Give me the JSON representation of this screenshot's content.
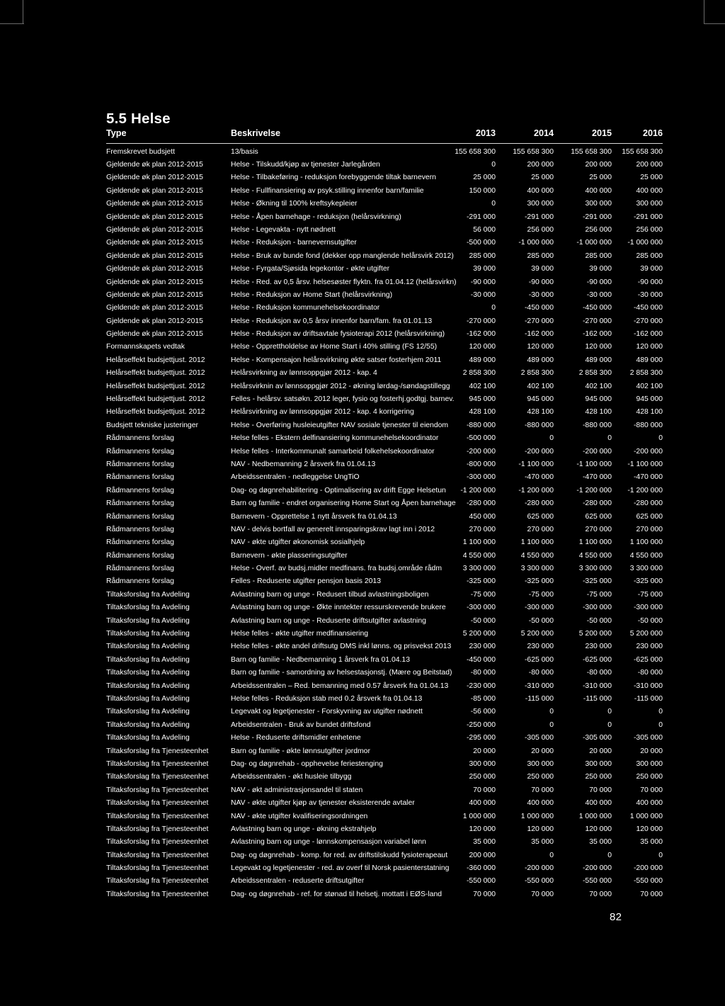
{
  "document": {
    "section_number": "5.5",
    "section_title": "5.5 Helse",
    "page_number": "82"
  },
  "table": {
    "columns": [
      {
        "key": "type",
        "label": "Type",
        "align": "left"
      },
      {
        "key": "desc",
        "label": "Beskrivelse",
        "align": "left"
      },
      {
        "key": "y2013",
        "label": "2013",
        "align": "right"
      },
      {
        "key": "y2014",
        "label": "2014",
        "align": "right"
      },
      {
        "key": "y2015",
        "label": "2015",
        "align": "right"
      },
      {
        "key": "y2016",
        "label": "2016",
        "align": "right"
      }
    ],
    "rows": [
      {
        "type": "Fremskrevet budsjett",
        "desc": "13/basis",
        "y2013": "155 658 300",
        "y2014": "155 658 300",
        "y2015": "155 658 300",
        "y2016": "155 658 300"
      },
      {
        "type": "Gjeldende øk plan 2012-2015",
        "desc": "Helse - Tilskudd/kjøp av tjenester Jarlegården",
        "y2013": "0",
        "y2014": "200 000",
        "y2015": "200 000",
        "y2016": "200 000"
      },
      {
        "type": "Gjeldende øk plan 2012-2015",
        "desc": "Helse - Tilbakeføring - reduksjon forebyggende tiltak barnevern",
        "y2013": "25 000",
        "y2014": "25 000",
        "y2015": "25 000",
        "y2016": "25 000"
      },
      {
        "type": "Gjeldende øk plan 2012-2015",
        "desc": "Helse - Fullfinansiering av psyk.stilling innenfor barn/familie",
        "y2013": "150 000",
        "y2014": "400 000",
        "y2015": "400 000",
        "y2016": "400 000"
      },
      {
        "type": "Gjeldende øk plan 2012-2015",
        "desc": "Helse - Økning til 100% kreftsykepleier",
        "y2013": "0",
        "y2014": "300 000",
        "y2015": "300 000",
        "y2016": "300 000"
      },
      {
        "type": "Gjeldende øk plan 2012-2015",
        "desc": "Helse - Åpen barnehage - reduksjon (helårsvirkning)",
        "y2013": "-291 000",
        "y2014": "-291 000",
        "y2015": "-291 000",
        "y2016": "-291 000"
      },
      {
        "type": "Gjeldende øk plan 2012-2015",
        "desc": "Helse - Legevakta - nytt nødnett",
        "y2013": "56 000",
        "y2014": "256 000",
        "y2015": "256 000",
        "y2016": "256 000"
      },
      {
        "type": "Gjeldende øk plan 2012-2015",
        "desc": "Helse - Reduksjon - barnevernsutgifter",
        "y2013": "-500 000",
        "y2014": "-1 000 000",
        "y2015": "-1 000 000",
        "y2016": "-1 000 000"
      },
      {
        "type": "Gjeldende øk plan 2012-2015",
        "desc": "Helse - Bruk av bunde fond (dekker opp manglende helårsvirk 2012)",
        "y2013": "285 000",
        "y2014": "285 000",
        "y2015": "285 000",
        "y2016": "285 000"
      },
      {
        "type": "Gjeldende øk plan 2012-2015",
        "desc": "Helse - Fyrgata/Sjøsida legekontor - økte utgifter",
        "y2013": "39 000",
        "y2014": "39 000",
        "y2015": "39 000",
        "y2016": "39 000"
      },
      {
        "type": "Gjeldende øk plan 2012-2015",
        "desc": "Helse - Red. av 0,5 årsv. helsesøster flyktn. fra 01.04.12 (helårsvirkn)",
        "y2013": "-90 000",
        "y2014": "-90 000",
        "y2015": "-90 000",
        "y2016": "-90 000"
      },
      {
        "type": "Gjeldende øk plan 2012-2015",
        "desc": "Helse - Reduksjon av Home Start (helårsvirkning)",
        "y2013": "-30 000",
        "y2014": "-30 000",
        "y2015": "-30 000",
        "y2016": "-30 000"
      },
      {
        "type": "Gjeldende øk plan 2012-2015",
        "desc": "Helse - Reduksjon kommunehelsekoordinator",
        "y2013": "0",
        "y2014": "-450 000",
        "y2015": "-450 000",
        "y2016": "-450 000"
      },
      {
        "type": "Gjeldende øk plan 2012-2015",
        "desc": "Helse - Reduksjon av 0,5 årsv innenfor barn/fam. fra 01.01.13",
        "y2013": "-270 000",
        "y2014": "-270 000",
        "y2015": "-270 000",
        "y2016": "-270 000"
      },
      {
        "type": "Gjeldende øk plan 2012-2015",
        "desc": "Helse - Reduksjon av driftsavtale fysioterapi 2012 (helårsvirkning)",
        "y2013": "-162 000",
        "y2014": "-162 000",
        "y2015": "-162 000",
        "y2016": "-162 000"
      },
      {
        "type": "Formannskapets vedtak",
        "desc": "Helse - Opprettholdelse av Home Start i 40% stilling (FS 12/55)",
        "y2013": "120 000",
        "y2014": "120 000",
        "y2015": "120 000",
        "y2016": "120 000"
      },
      {
        "type": "Helårseffekt budsjettjust. 2012",
        "desc": "Helse - Kompensajon helårsvirkning økte satser fosterhjem 2011",
        "y2013": "489 000",
        "y2014": "489 000",
        "y2015": "489 000",
        "y2016": "489 000"
      },
      {
        "type": "Helårseffekt budsjettjust. 2012",
        "desc": "Helårsvirkning av lønnsoppgjør 2012 - kap. 4",
        "y2013": "2 858 300",
        "y2014": "2 858 300",
        "y2015": "2 858 300",
        "y2016": "2 858 300"
      },
      {
        "type": "Helårseffekt budsjettjust. 2012",
        "desc": "Helårsvirknin av lønnsoppgjør 2012 - økning lørdag-/søndagstillegg",
        "y2013": "402 100",
        "y2014": "402 100",
        "y2015": "402 100",
        "y2016": "402 100"
      },
      {
        "type": "Helårseffekt budsjettjust. 2012",
        "desc": "Felles - helårsv. satsøkn. 2012 leger, fysio og fosterhj.godtgj. barnev.",
        "y2013": "945 000",
        "y2014": "945 000",
        "y2015": "945 000",
        "y2016": "945 000"
      },
      {
        "type": "Helårseffekt budsjettjust. 2012",
        "desc": "Helårsvirkning av lønnsoppgjør 2012 - kap. 4 korrigering",
        "y2013": "428 100",
        "y2014": "428 100",
        "y2015": "428 100",
        "y2016": "428 100"
      },
      {
        "type": "Budsjett tekniske justeringer",
        "desc": "Helse - Overføring husleieutgifter NAV sosiale tjenester til eiendom",
        "y2013": "-880 000",
        "y2014": "-880 000",
        "y2015": "-880 000",
        "y2016": "-880 000"
      },
      {
        "type": "Rådmannens forslag",
        "desc": "Helse felles - Ekstern delfinansiering kommunehelsekoordinator",
        "y2013": "-500 000",
        "y2014": "0",
        "y2015": "0",
        "y2016": "0"
      },
      {
        "type": "Rådmannens forslag",
        "desc": "Helse felles - Interkommunalt samarbeid folkehelsekoordinator",
        "y2013": "-200 000",
        "y2014": "-200 000",
        "y2015": "-200 000",
        "y2016": "-200 000"
      },
      {
        "type": "Rådmannens forslag",
        "desc": "NAV - Nedbemanning 2 årsverk fra 01.04.13",
        "y2013": "-800 000",
        "y2014": "-1 100 000",
        "y2015": "-1 100 000",
        "y2016": "-1 100 000"
      },
      {
        "type": "Rådmannens forslag",
        "desc": "Arbeidssentralen - nedleggelse UngTiO",
        "y2013": "-300 000",
        "y2014": "-470 000",
        "y2015": "-470 000",
        "y2016": "-470 000"
      },
      {
        "type": "Rådmannens forslag",
        "desc": "Dag- og døgnrehabilitering - Optimalisering av drift Egge Helsetun",
        "y2013": "-1 200 000",
        "y2014": "-1 200 000",
        "y2015": "-1 200 000",
        "y2016": "-1 200 000"
      },
      {
        "type": "Rådmannens forslag",
        "desc": "Barn og familie - endret organisering Home Start og Åpen barnehage",
        "y2013": "-280 000",
        "y2014": "-280 000",
        "y2015": "-280 000",
        "y2016": "-280 000"
      },
      {
        "type": "Rådmannens forslag",
        "desc": "Barnevern - Opprettelse 1 nytt årsverk fra 01.04.13",
        "y2013": "450 000",
        "y2014": "625 000",
        "y2015": "625 000",
        "y2016": "625 000"
      },
      {
        "type": "Rådmannens forslag",
        "desc": "NAV - delvis bortfall av generelt innsparingskrav lagt inn i 2012",
        "y2013": "270 000",
        "y2014": "270 000",
        "y2015": "270 000",
        "y2016": "270 000"
      },
      {
        "type": "Rådmannens forslag",
        "desc": "NAV - økte utgifter økonomisk sosialhjelp",
        "y2013": "1 100 000",
        "y2014": "1 100 000",
        "y2015": "1 100 000",
        "y2016": "1 100 000"
      },
      {
        "type": "Rådmannens forslag",
        "desc": "Barnevern - økte plasseringsutgifter",
        "y2013": "4 550 000",
        "y2014": "4 550 000",
        "y2015": "4 550 000",
        "y2016": "4 550 000"
      },
      {
        "type": "Rådmannens forslag",
        "desc": "Helse - Overf. av budsj.midler medfinans. fra budsj.område rådm",
        "y2013": "3 300 000",
        "y2014": "3 300 000",
        "y2015": "3 300 000",
        "y2016": "3 300 000"
      },
      {
        "type": "Rådmannens forslag",
        "desc": "Felles - Reduserte utgifter pensjon basis 2013",
        "y2013": "-325 000",
        "y2014": "-325 000",
        "y2015": "-325 000",
        "y2016": "-325 000"
      },
      {
        "type": "Tiltaksforslag fra Avdeling",
        "desc": "Avlastning barn og unge - Redusert tilbud avlastningsboligen",
        "y2013": "-75 000",
        "y2014": "-75 000",
        "y2015": "-75 000",
        "y2016": "-75 000"
      },
      {
        "type": "Tiltaksforslag fra Avdeling",
        "desc": "Avlastning barn og unge - Økte inntekter ressurskrevende brukere",
        "y2013": "-300 000",
        "y2014": "-300 000",
        "y2015": "-300 000",
        "y2016": "-300 000"
      },
      {
        "type": "Tiltaksforslag fra Avdeling",
        "desc": "Avlastning barn og unge - Reduserte driftsutgifter avlastning",
        "y2013": "-50 000",
        "y2014": "-50 000",
        "y2015": "-50 000",
        "y2016": "-50 000"
      },
      {
        "type": "Tiltaksforslag fra Avdeling",
        "desc": "Helse felles - økte utgifter medfinansiering",
        "y2013": "5 200 000",
        "y2014": "5 200 000",
        "y2015": "5 200 000",
        "y2016": "5 200 000"
      },
      {
        "type": "Tiltaksforslag fra Avdeling",
        "desc": "Helse felles - økte andel driftsutg DMS inkl lønns. og prisvekst 2013",
        "y2013": "230 000",
        "y2014": "230 000",
        "y2015": "230 000",
        "y2016": "230 000"
      },
      {
        "type": "Tiltaksforslag fra Avdeling",
        "desc": "Barn og familie - Nedbemanning 1 årsverk fra 01.04.13",
        "y2013": "-450 000",
        "y2014": "-625 000",
        "y2015": "-625 000",
        "y2016": "-625 000"
      },
      {
        "type": "Tiltaksforslag fra Avdeling",
        "desc": "Barn og familie - samordning av helsestasjonstj. (Mære og Beitstad)",
        "y2013": "-80 000",
        "y2014": "-80 000",
        "y2015": "-80 000",
        "y2016": "-80 000"
      },
      {
        "type": "Tiltaksforslag fra Avdeling",
        "desc": "Arbeidssentralen – Red. bemanning med 0.57 årsverk fra 01.04.13",
        "y2013": "-230 000",
        "y2014": "-310 000",
        "y2015": "-310 000",
        "y2016": "-310 000"
      },
      {
        "type": "Tiltaksforslag fra Avdeling",
        "desc": "Helse felles - Reduksjon stab med 0.2 årsverk fra 01.04.13",
        "y2013": "-85 000",
        "y2014": "-115 000",
        "y2015": "-115 000",
        "y2016": "-115 000"
      },
      {
        "type": "Tiltaksforslag fra Avdeling",
        "desc": "Legevakt og legetjenester - Forskyvning av utgifter nødnett",
        "y2013": "-56 000",
        "y2014": "0",
        "y2015": "0",
        "y2016": "0"
      },
      {
        "type": "Tiltaksforslag fra Avdeling",
        "desc": "Arbeidsentralen - Bruk av bundet driftsfond",
        "y2013": "-250 000",
        "y2014": "0",
        "y2015": "0",
        "y2016": "0"
      },
      {
        "type": "Tiltaksforslag fra Avdeling",
        "desc": "Helse - Reduserte driftsmidler enhetene",
        "y2013": "-295 000",
        "y2014": "-305 000",
        "y2015": "-305 000",
        "y2016": "-305 000"
      },
      {
        "type": "Tiltaksforslag fra Tjenesteenhet",
        "desc": "Barn og familie - økte lønnsutgifter jordmor",
        "y2013": "20 000",
        "y2014": "20 000",
        "y2015": "20 000",
        "y2016": "20 000"
      },
      {
        "type": "Tiltaksforslag fra Tjenesteenhet",
        "desc": "Dag- og døgnrehab - opphevelse feriestenging",
        "y2013": "300 000",
        "y2014": "300 000",
        "y2015": "300 000",
        "y2016": "300 000"
      },
      {
        "type": "Tiltaksforslag fra Tjenesteenhet",
        "desc": "Arbeidssentralen - økt husleie tilbygg",
        "y2013": "250 000",
        "y2014": "250 000",
        "y2015": "250 000",
        "y2016": "250 000"
      },
      {
        "type": "Tiltaksforslag fra Tjenesteenhet",
        "desc": "NAV - økt administrasjonsandel til staten",
        "y2013": "70 000",
        "y2014": "70 000",
        "y2015": "70 000",
        "y2016": "70 000"
      },
      {
        "type": "Tiltaksforslag fra Tjenesteenhet",
        "desc": "NAV - økte utgifter kjøp av tjenester eksisterende avtaler",
        "y2013": "400 000",
        "y2014": "400 000",
        "y2015": "400 000",
        "y2016": "400 000"
      },
      {
        "type": "Tiltaksforslag fra Tjenesteenhet",
        "desc": "NAV - økte utgifter kvalifiseringsordningen",
        "y2013": "1 000 000",
        "y2014": "1 000 000",
        "y2015": "1 000 000",
        "y2016": "1 000 000"
      },
      {
        "type": "Tiltaksforslag fra Tjenesteenhet",
        "desc": "Avlastning barn og unge - økning ekstrahjelp",
        "y2013": "120 000",
        "y2014": "120 000",
        "y2015": "120 000",
        "y2016": "120 000"
      },
      {
        "type": "Tiltaksforslag fra Tjenesteenhet",
        "desc": "Avlastning barn og unge - lønnskompensasjon variabel lønn",
        "y2013": "35 000",
        "y2014": "35 000",
        "y2015": "35 000",
        "y2016": "35 000"
      },
      {
        "type": "Tiltaksforslag fra Tjenesteenhet",
        "desc": "Dag- og døgnrehab - komp. for red. av driftstilskudd fysioterapeaut",
        "y2013": "200 000",
        "y2014": "0",
        "y2015": "0",
        "y2016": "0"
      },
      {
        "type": "Tiltaksforslag fra Tjenesteenhet",
        "desc": "Legevakt og legetjenester - red. av overf til Norsk pasienterstatning",
        "y2013": "-360 000",
        "y2014": "-200 000",
        "y2015": "-200 000",
        "y2016": "-200 000"
      },
      {
        "type": "Tiltaksforslag fra Tjenesteenhet",
        "desc": "Arbeidssentralen - reduserte driftsutgifter",
        "y2013": "-550 000",
        "y2014": "-550 000",
        "y2015": "-550 000",
        "y2016": "-550 000"
      },
      {
        "type": "Tiltaksforslag fra Tjenesteenhet",
        "desc": "Dag- og døgnrehab - ref. for stønad til helsetj. mottatt i EØS-land",
        "y2013": "70 000",
        "y2014": "70 000",
        "y2015": "70 000",
        "y2016": "70 000"
      }
    ]
  }
}
